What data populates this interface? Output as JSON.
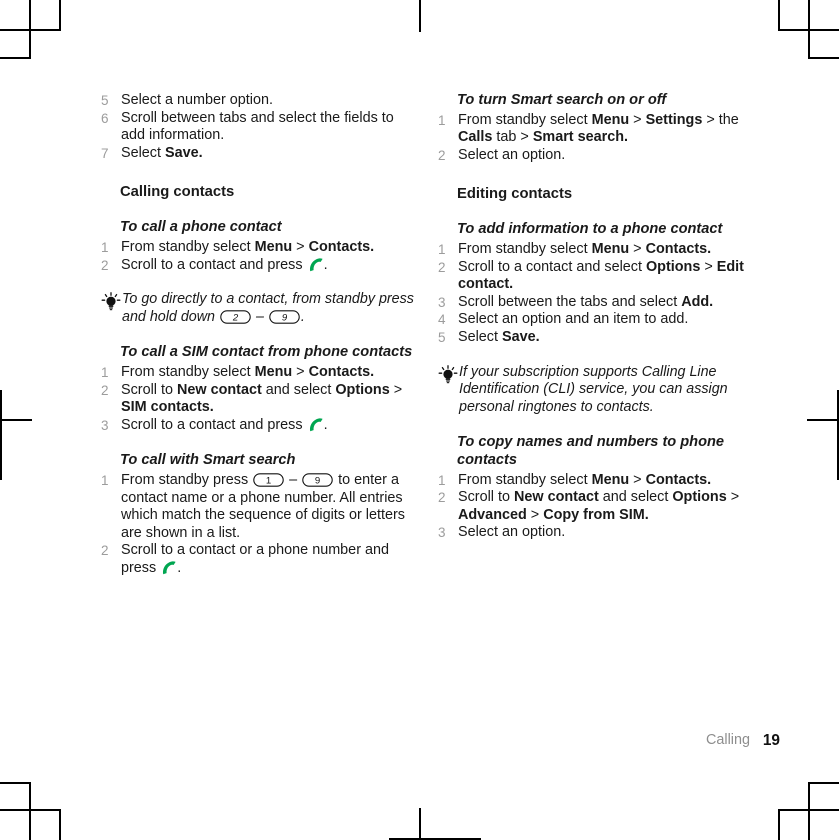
{
  "document": {
    "footer_chapter": "Calling",
    "footer_page": "19",
    "icons": {
      "tip": "lightbulb-icon",
      "call": "green-call-handset-icon",
      "keycap": "phone-keypad-key-icon"
    },
    "colors": {
      "call_green": "#00a651",
      "step_number_gray": "#9c9c9c",
      "footer_chapter_gray": "#8e8e8e",
      "text_black": "#1a1a1a"
    }
  },
  "left_column": {
    "continued_steps": [
      {
        "num": "5",
        "html": "Select a number option."
      },
      {
        "num": "6",
        "html": "Scroll between tabs and select the fields to add information."
      },
      {
        "num": "7",
        "html": "Select <b>Save.</b>"
      }
    ],
    "section_heading": "Calling contacts",
    "tasks": [
      {
        "title": "To call a phone contact",
        "steps": [
          {
            "num": "1",
            "html": "From standby select <b>Menu</b> &gt; <b>Contacts.</b>"
          },
          {
            "num": "2",
            "html": "Scroll to a contact and press <span class=\"call\"></span>."
          }
        ]
      },
      {
        "title": "To call a SIM contact from phone contacts",
        "steps": [
          {
            "num": "1",
            "html": "From standby select <b>Menu</b> &gt; <b>Contacts.</b>"
          },
          {
            "num": "2",
            "html": "Scroll to <b>New contact</b> and select <b>Options</b> &gt; <b>SIM contacts.</b>"
          },
          {
            "num": "3",
            "html": "Scroll to a contact and press <span class=\"call\"></span>."
          }
        ]
      },
      {
        "title": "To call with Smart search",
        "steps": [
          {
            "num": "1",
            "html": "From standby press <span class=\"key\">1</span> &ndash; <span class=\"key\">9</span> to enter a contact name or a phone number. All entries which match the sequence of digits or letters are shown in a list."
          },
          {
            "num": "2",
            "html": "Scroll to a contact or a phone number and press <span class=\"call\"></span>."
          }
        ]
      }
    ],
    "tip": {
      "html": "To go directly to a contact, from standby press and hold down <span class=\"key\">2</span> &ndash; <span class=\"key\">9</span>."
    }
  },
  "right_column": {
    "tasks_top": [
      {
        "title": "To turn Smart search on or off",
        "steps": [
          {
            "num": "1",
            "html": "From standby select <b>Menu</b> &gt; <b>Settings</b> &gt; the <b>Calls</b> tab &gt; <b>Smart search.</b>"
          },
          {
            "num": "2",
            "html": "Select an option."
          }
        ]
      }
    ],
    "section_heading": "Editing contacts",
    "tasks": [
      {
        "title": "To add information to a phone contact",
        "steps": [
          {
            "num": "1",
            "html": "From standby select <b>Menu</b> &gt; <b>Contacts.</b>"
          },
          {
            "num": "2",
            "html": "Scroll to a contact and select <b>Options</b> &gt; <b>Edit contact.</b>"
          },
          {
            "num": "3",
            "html": "Scroll between the tabs and select <b>Add.</b>"
          },
          {
            "num": "4",
            "html": "Select an option and an item to add."
          },
          {
            "num": "5",
            "html": "Select <b>Save.</b>"
          }
        ]
      },
      {
        "title": "To copy names and numbers to phone contacts",
        "steps": [
          {
            "num": "1",
            "html": "From standby select <b>Menu</b> &gt; <b>Contacts.</b>"
          },
          {
            "num": "2",
            "html": "Scroll to <b>New contact</b> and select <b>Options</b> &gt; <b>Advanced</b> &gt; <b>Copy from SIM.</b>"
          },
          {
            "num": "3",
            "html": "Select an option."
          }
        ]
      }
    ],
    "tip": {
      "html": "If your subscription supports Calling Line Identification (CLI) service, you can assign personal ringtones to contacts."
    }
  }
}
